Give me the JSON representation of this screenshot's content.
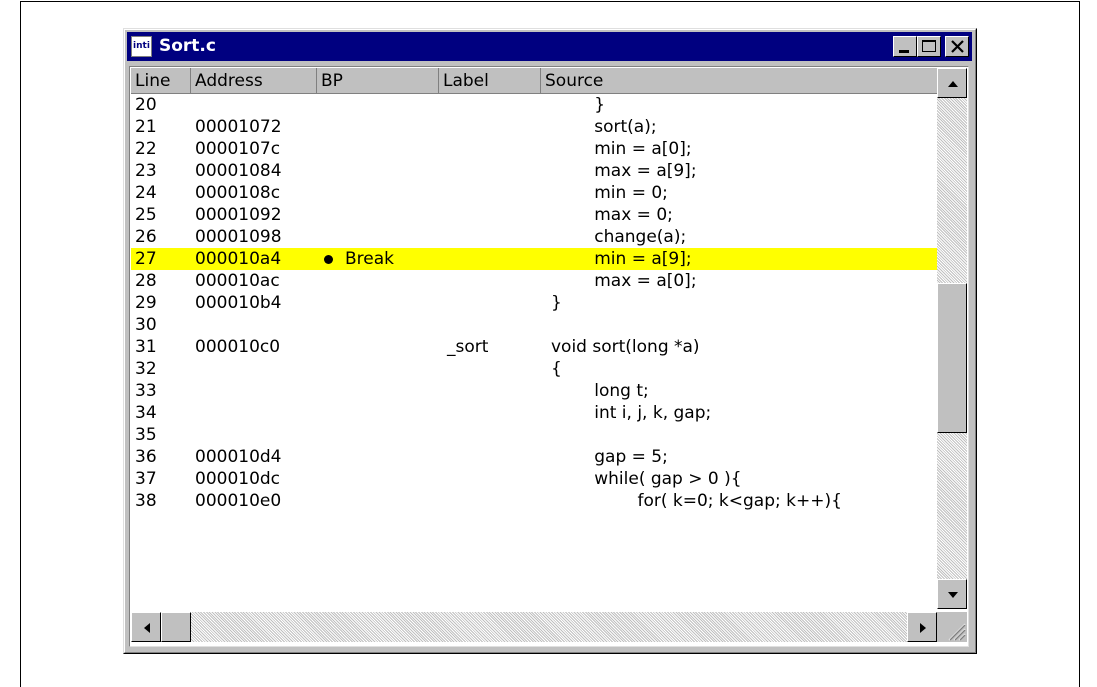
{
  "window": {
    "title": "Sort.c",
    "icon_text": "inti",
    "icon": "source-file-icon",
    "controls": [
      "minimize-icon",
      "maximize-icon",
      "close-icon"
    ]
  },
  "columns": [
    "Line",
    "Address",
    "BP",
    "Label",
    "Source"
  ],
  "rows": [
    {
      "line": "20",
      "address": "",
      "bp": "",
      "label": "",
      "source": "        }"
    },
    {
      "line": "21",
      "address": "00001072",
      "bp": "",
      "label": "",
      "source": "        sort(a);"
    },
    {
      "line": "22",
      "address": "0000107c",
      "bp": "",
      "label": "",
      "source": "        min = a[0];"
    },
    {
      "line": "23",
      "address": "00001084",
      "bp": "",
      "label": "",
      "source": "        max = a[9];"
    },
    {
      "line": "24",
      "address": "0000108c",
      "bp": "",
      "label": "",
      "source": "        min = 0;"
    },
    {
      "line": "25",
      "address": "00001092",
      "bp": "",
      "label": "",
      "source": "        max = 0;"
    },
    {
      "line": "26",
      "address": "00001098",
      "bp": "",
      "label": "",
      "source": "        change(a);"
    },
    {
      "line": "27",
      "address": "000010a4",
      "bp": "Break",
      "label": "",
      "source": "        min = a[9];",
      "highlight": true
    },
    {
      "line": "28",
      "address": "000010ac",
      "bp": "",
      "label": "",
      "source": "        max = a[0];"
    },
    {
      "line": "29",
      "address": "000010b4",
      "bp": "",
      "label": "",
      "source": "}"
    },
    {
      "line": "30",
      "address": "",
      "bp": "",
      "label": "",
      "source": ""
    },
    {
      "line": "31",
      "address": "000010c0",
      "bp": "",
      "label": "_sort",
      "source": "void sort(long *a)"
    },
    {
      "line": "32",
      "address": "",
      "bp": "",
      "label": "",
      "source": "{"
    },
    {
      "line": "33",
      "address": "",
      "bp": "",
      "label": "",
      "source": "        long t;"
    },
    {
      "line": "34",
      "address": "",
      "bp": "",
      "label": "",
      "source": "        int i, j, k, gap;"
    },
    {
      "line": "35",
      "address": "",
      "bp": "",
      "label": "",
      "source": ""
    },
    {
      "line": "36",
      "address": "000010d4",
      "bp": "",
      "label": "",
      "source": "        gap = 5;"
    },
    {
      "line": "37",
      "address": "000010dc",
      "bp": "",
      "label": "",
      "source": "        while( gap > 0 ){"
    },
    {
      "line": "38",
      "address": "000010e0",
      "bp": "",
      "label": "",
      "source": "                for( k=0; k<gap; k++){"
    }
  ],
  "colors": {
    "titlebar": "#000080",
    "highlight": "#ffff00",
    "face": "#c0c0c0"
  }
}
